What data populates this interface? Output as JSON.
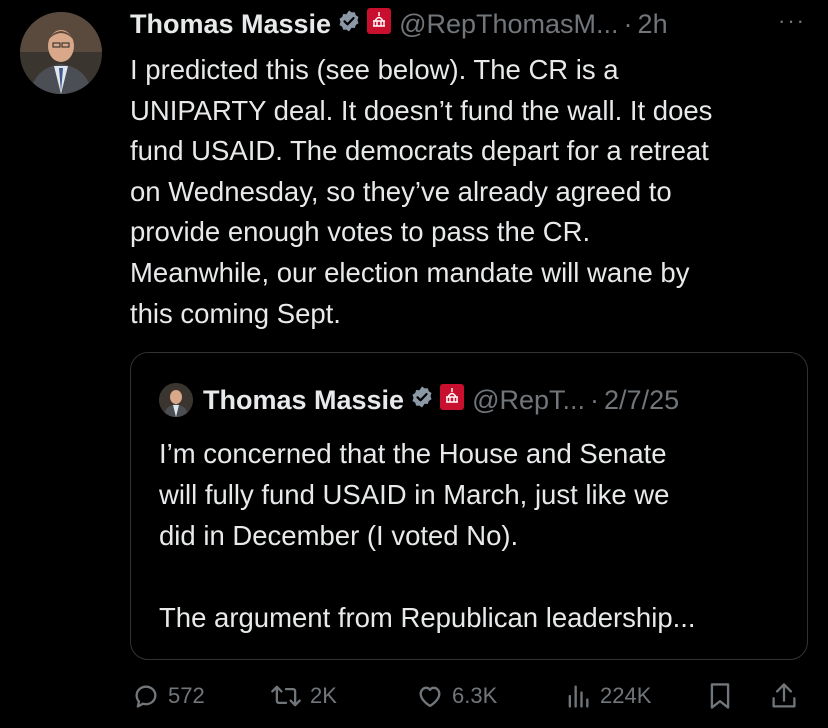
{
  "tweet": {
    "author_name": "Thomas Massie",
    "handle": "@RepThomasM...",
    "separator": "·",
    "time": "2h",
    "more_label": "···",
    "text": "I predicted this (see below). The CR is a\nUNIPARTY deal. It doesn’t fund the wall. It does\nfund USAID. The democrats depart for a retreat\non Wednesday, so they’ve already agreed to\nprovide enough votes to pass the CR.\nMeanwhile, our election mandate will wane by\nthis coming Sept."
  },
  "quoted_tweet": {
    "author_name": "Thomas Massie",
    "handle": "@RepT...",
    "separator": "·",
    "date": "2/7/25",
    "text": "I’m concerned that the House and Senate\nwill fully fund USAID in March, just like we\ndid in December (I voted No).\n\nThe argument from Republican leadership..."
  },
  "actions": {
    "replies": "572",
    "reposts": "2K",
    "likes": "6.3K",
    "views": "224K"
  },
  "icons": [
    "verified-badge-icon",
    "congress-badge-icon",
    "reply-icon",
    "repost-icon",
    "like-icon",
    "views-icon",
    "bookmark-icon",
    "share-icon"
  ],
  "colors": {
    "background": "#000000",
    "text": "#e7e9ea",
    "muted": "#71767b",
    "verified": "#8b98a5",
    "congress_badge": "#c8102e"
  }
}
